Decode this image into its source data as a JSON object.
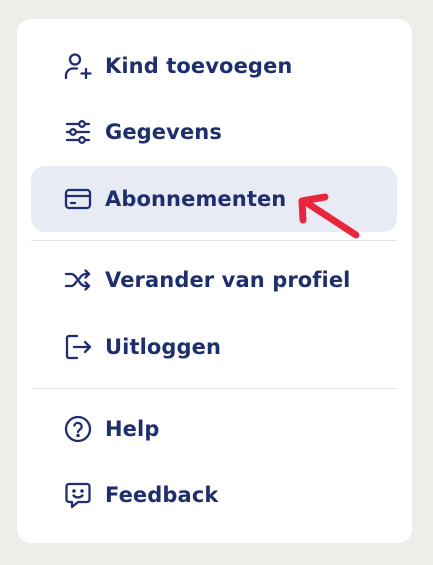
{
  "menu": {
    "items": [
      {
        "label": "Kind toevoegen",
        "icon": "add-user-icon"
      },
      {
        "label": "Gegevens",
        "icon": "sliders-icon"
      },
      {
        "label": "Abonnementen",
        "icon": "credit-card-icon",
        "active": true
      },
      {
        "label": "Verander van profiel",
        "icon": "shuffle-icon"
      },
      {
        "label": "Uitloggen",
        "icon": "logout-icon"
      },
      {
        "label": "Help",
        "icon": "help-circle-icon"
      },
      {
        "label": "Feedback",
        "icon": "feedback-icon"
      }
    ]
  },
  "colors": {
    "text": "#1f2f6e",
    "active_background": "#e8ebf4",
    "annotation_arrow": "#e8273c",
    "page_background": "#eeede9",
    "card_background": "#ffffff"
  }
}
